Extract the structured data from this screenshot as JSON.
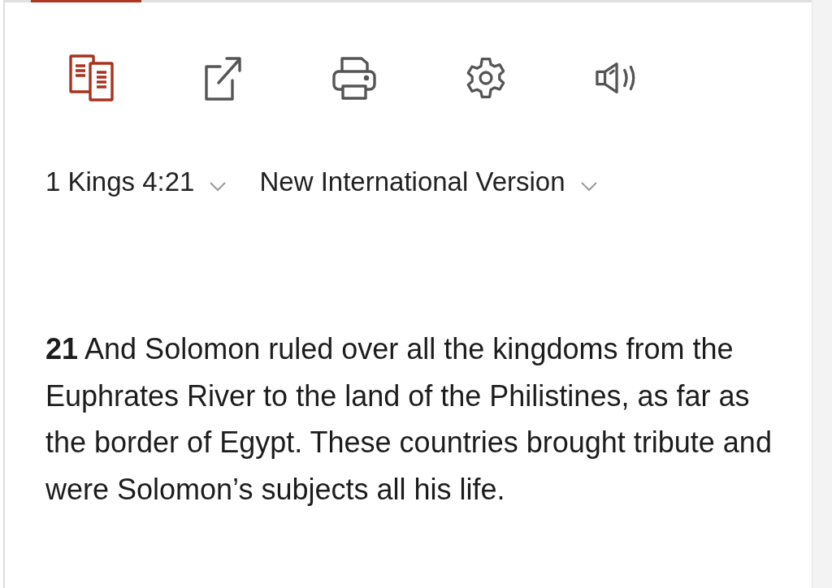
{
  "toolbar": [
    {
      "kind": "parallel",
      "selected": true
    },
    {
      "kind": "share",
      "selected": false
    },
    {
      "kind": "print",
      "selected": false
    },
    {
      "kind": "settings",
      "selected": false
    },
    {
      "kind": "audio",
      "selected": false
    }
  ],
  "selectors": [
    {
      "label": "1 Kings 4:21"
    },
    {
      "label": "New International Version"
    }
  ],
  "passage": "**21** And Solomon ruled over all the kingdoms from the Euphrates River to the land of the Philistines, as far as the border of Egypt. These countries brought tribute and were Solomon’s subjects all his life."
}
